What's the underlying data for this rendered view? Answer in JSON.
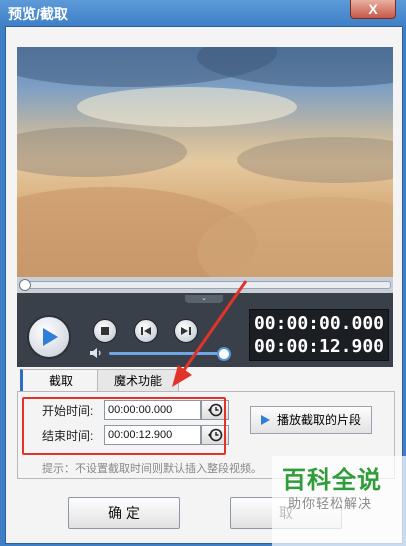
{
  "window": {
    "title": "预览/截取",
    "close_label": "X"
  },
  "player": {
    "collapse_glyph": "⌄",
    "time_current": "00:00:00.000",
    "time_total": "00:00:12.900",
    "progress": 0.0,
    "volume": 0.95
  },
  "tabs": [
    {
      "label": "截取",
      "active": true
    },
    {
      "label": "魔术功能",
      "active": false
    }
  ],
  "cut": {
    "start_label": "开始时间:",
    "start_value": "00:00:00.000",
    "end_label": "结束时间:",
    "end_value": "00:00:12.900",
    "play_segment_label": "播放截取的片段",
    "hint": "提示：不设置截取时间则默认插入整段视频。"
  },
  "buttons": {
    "ok": "确 定",
    "cancel": "取"
  },
  "watermark": {
    "logo": "百科全说",
    "slogan": "助你轻松解决"
  },
  "colors": {
    "accent": "#3f7fc6",
    "highlight": "#e2332b",
    "brand": "#2f9e38"
  }
}
